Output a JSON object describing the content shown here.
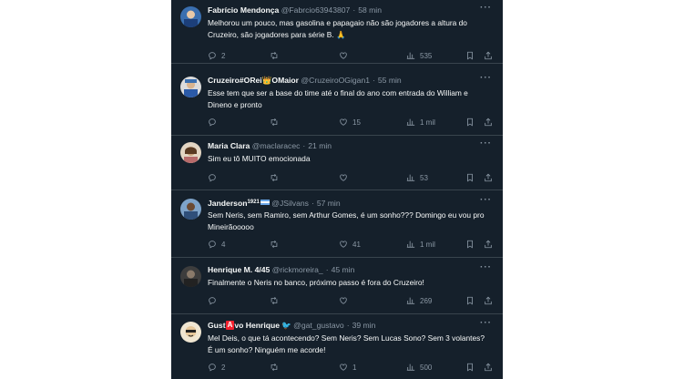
{
  "tweets": [
    {
      "name": "Fabrício Mendonça",
      "handle": "@Fabrcio63943807",
      "time": "58 min",
      "text": "Melhorou um pouco, mas gasolina e papagaio não são jogadores a altura do Cruzeiro, são jogadores para série B. 🙏",
      "replies": "2",
      "retweets": "",
      "likes": "",
      "views": "535",
      "avatar_color": "#3a6fb0"
    },
    {
      "name_prefix": "Cruzeiro#ORei",
      "name_suffix": "OMaior",
      "crown": "👑",
      "handle": "@CruzeiroOGigan1",
      "time": "55 min",
      "text": "Esse tem que ser a base do time até o final do ano com entrada do William e Dineno e pronto",
      "replies": "",
      "retweets": "",
      "likes": "15",
      "views": "1 mil",
      "avatar_color": "#d9d9d9"
    },
    {
      "name": "Maria Clara",
      "handle": "@maclaracec",
      "time": "21 min",
      "text": "Sim eu tô MUITO emocionada",
      "replies": "",
      "retweets": "",
      "likes": "",
      "views": "53",
      "avatar_color": "#c8a27a"
    },
    {
      "name": "Janderson",
      "name_sup": "1921",
      "handle": "@JSilvans",
      "time": "57 min",
      "text": "Sem Neris, sem Ramiro, sem Arthur Gomes, é um sonho??? Domingo eu vou pro Mineirãooooo",
      "replies": "4",
      "retweets": "",
      "likes": "41",
      "views": "1 mil",
      "avatar_color": "#6b8fb8"
    },
    {
      "name": "Henrique M. 4/45",
      "handle": "@rickmoreira_",
      "time": "45 min",
      "text": "Finalmente o Neris no banco, próximo passo é fora do Cruzeiro!",
      "replies": "",
      "retweets": "",
      "likes": "",
      "views": "269",
      "avatar_color": "#4a4a4a"
    },
    {
      "name_prefix": "Gust",
      "name_badge": "A",
      "name_suffix": "vo Henrique",
      "handle": "@gat_gustavo",
      "time": "39 min",
      "text": "Mel Deis, o que tá acontecendo? Sem Neris? Sem Lucas Sono? Sem 3 volantes? É um sonho? Ninguém me acorde!",
      "replies": "2",
      "retweets": "",
      "likes": "1",
      "views": "500",
      "avatar_color": "#e6d2b0"
    }
  ],
  "ui": {
    "more_glyph": "···",
    "separator": "·",
    "bird_glyph": "🐦"
  },
  "colors": {
    "background": "#15202b",
    "text": "#f7f9f9",
    "muted": "#8b98a5",
    "divider": "#38444d"
  }
}
